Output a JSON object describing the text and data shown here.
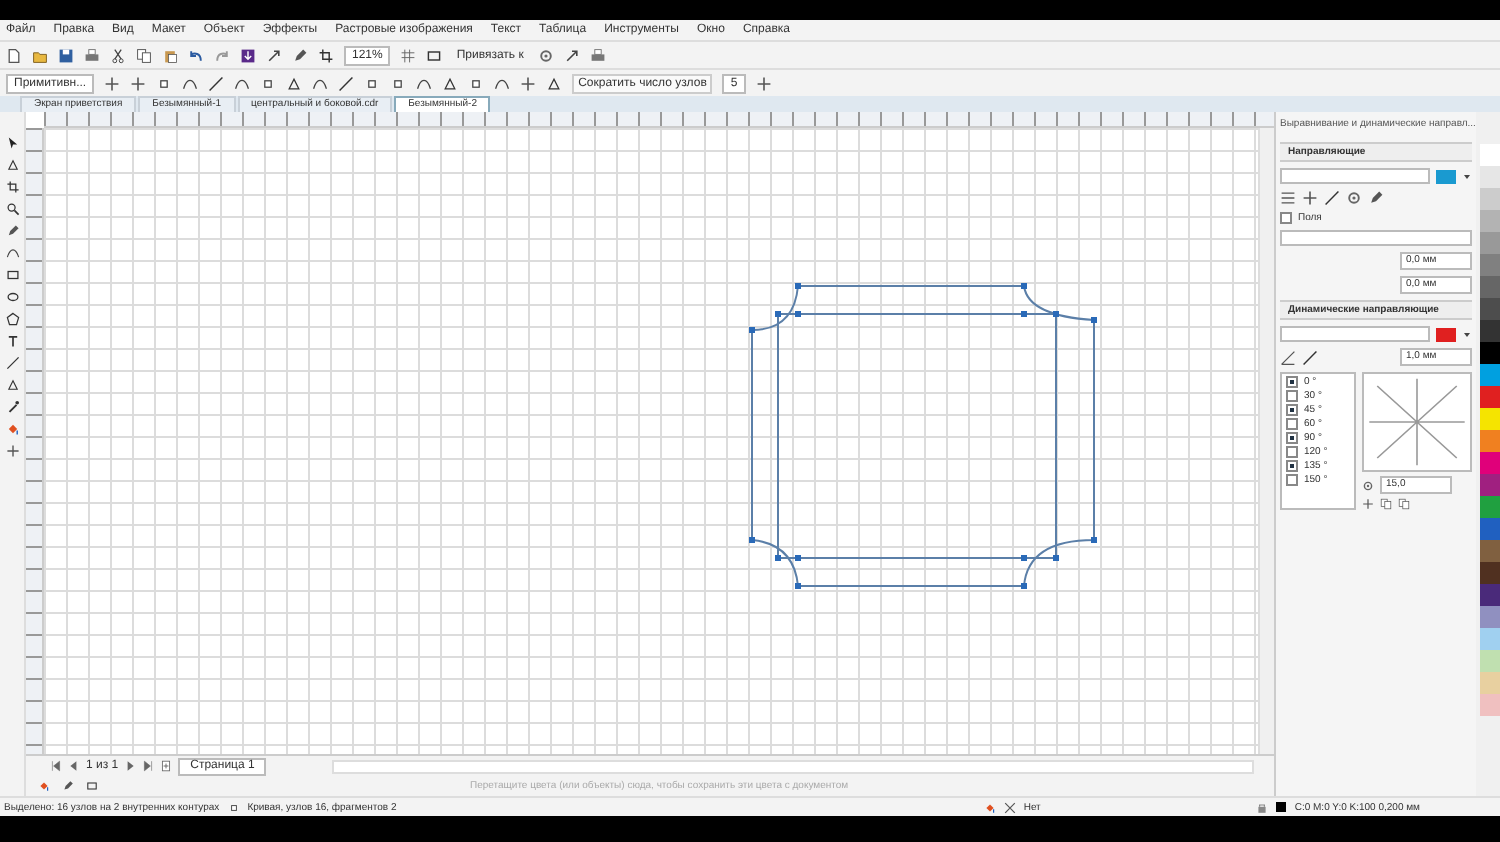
{
  "menu": [
    "Файл",
    "Правка",
    "Вид",
    "Макет",
    "Объект",
    "Эффекты",
    "Растровые изображения",
    "Текст",
    "Таблица",
    "Инструменты",
    "Окно",
    "Справка"
  ],
  "toolbar": {
    "zoom": "121%",
    "snap": "Привязать к"
  },
  "property_bar": {
    "preset": "Примитивн...",
    "reduce_nodes": "Сократить число узлов",
    "count": "5"
  },
  "tabs": [
    {
      "label": "Экран приветствия",
      "selected": false
    },
    {
      "label": "Безымянный-1",
      "selected": false
    },
    {
      "label": "центральный и боковой.cdr",
      "selected": false
    },
    {
      "label": "Безымянный-2",
      "selected": true
    }
  ],
  "docker": {
    "title": "Выравнивание и динамические направл...",
    "guides": {
      "title": "Направляющие",
      "color": "#1a9ad0"
    },
    "margins": {
      "title": "Поля",
      "checked": false,
      "values": [
        "0,0 мм",
        "0,0 мм"
      ]
    },
    "dynamic": {
      "title": "Динамические направляющие",
      "color": "#e02020",
      "width": "1,0 мм",
      "step": "15,0",
      "angles": [
        {
          "label": "0 °",
          "checked": true
        },
        {
          "label": "30 °",
          "checked": false
        },
        {
          "label": "45 °",
          "checked": true
        },
        {
          "label": "60 °",
          "checked": false
        },
        {
          "label": "90 °",
          "checked": true
        },
        {
          "label": "120 °",
          "checked": false
        },
        {
          "label": "135 °",
          "checked": true
        },
        {
          "label": "150 °",
          "checked": false
        }
      ]
    }
  },
  "palette": [
    {
      "color": "#ffffff"
    },
    {
      "color": "#e6e6e6"
    },
    {
      "color": "#cccccc"
    },
    {
      "color": "#b3b3b3"
    },
    {
      "color": "#999999"
    },
    {
      "color": "#808080"
    },
    {
      "color": "#666666"
    },
    {
      "color": "#4d4d4d"
    },
    {
      "color": "#333333"
    },
    {
      "color": "#000000"
    },
    {
      "color": "#00a0e0"
    },
    {
      "color": "#e02020"
    },
    {
      "color": "#f5e400"
    },
    {
      "color": "#f08020"
    },
    {
      "color": "#e0007a"
    },
    {
      "color": "#a02080"
    },
    {
      "color": "#20a040"
    },
    {
      "color": "#2060c0"
    },
    {
      "color": "#806040"
    },
    {
      "color": "#503020"
    },
    {
      "color": "#4a2a7a"
    },
    {
      "color": "#9090c0"
    },
    {
      "color": "#a0d0f0"
    },
    {
      "color": "#c0e0b0"
    },
    {
      "color": "#e8d0a0"
    },
    {
      "color": "#f0c0c0"
    }
  ],
  "page_nav": {
    "counter": "1 из 1",
    "page_tab": "Страница 1"
  },
  "hint": "Перетащите цвета (или объекты) сюда, чтобы сохранить эти цвета с документом",
  "status": {
    "selection": "Выделено: 16 узлов на 2 внутренних контурах",
    "curve": "Кривая, узлов 16, фрагментов 2",
    "fill": "Нет",
    "outline": "C:0 M:0 Y:0 K:100 0,200 мм"
  }
}
